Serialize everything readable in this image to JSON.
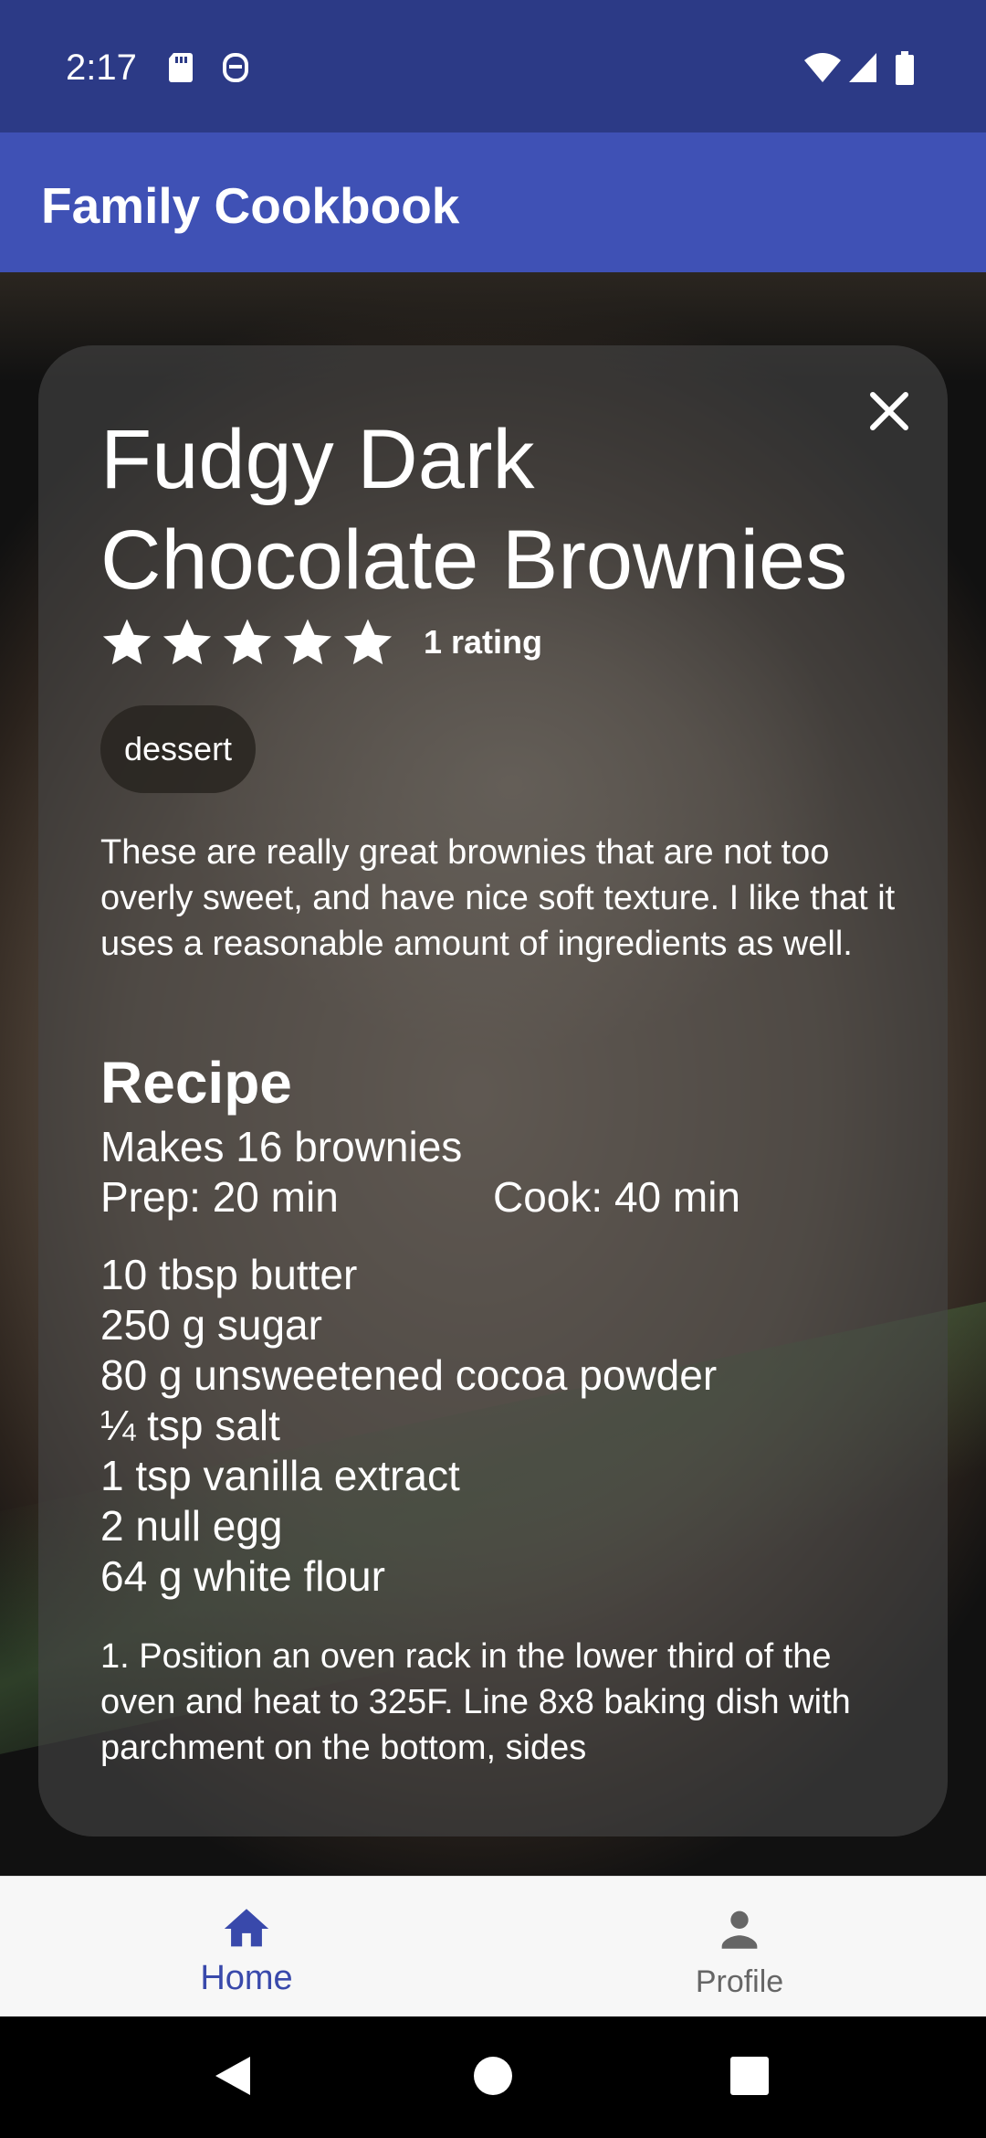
{
  "status_bar": {
    "time": "2:17"
  },
  "app_bar": {
    "title": "Family Cookbook"
  },
  "recipe": {
    "title": "Fudgy Dark Chocolate Brownies",
    "star_count": 5,
    "rating_value": 5,
    "rating_label": "1 rating",
    "tag": "dessert",
    "description": "These are really great brownies that are not too overly sweet, and have nice soft texture. I like that it uses a reasonable amount of ingredients as well.",
    "section_heading": "Recipe",
    "yield": "Makes 16 brownies",
    "prep_time": "Prep: 20 min",
    "cook_time": "Cook: 40 min",
    "ingredients": [
      "10 tbsp butter",
      "250 g sugar",
      "80 g unsweetened cocoa powder",
      "¼ tsp salt",
      "1 tsp vanilla extract",
      "2 null egg",
      "64 g white flour"
    ],
    "first_step": "1. Position an oven rack in the lower third of the oven and heat to 325F. Line 8x8 baking dish with parchment on the bottom, sides"
  },
  "bottom_nav": {
    "items": [
      {
        "label": "Home",
        "icon": "home-icon",
        "selected": true
      },
      {
        "label": "Profile",
        "icon": "person-icon",
        "selected": false
      }
    ]
  },
  "colors": {
    "status_bar": "#2c3a86",
    "app_bar": "#3f51b5",
    "nav_selected": "#3949ab",
    "nav_unselected": "#666666"
  }
}
